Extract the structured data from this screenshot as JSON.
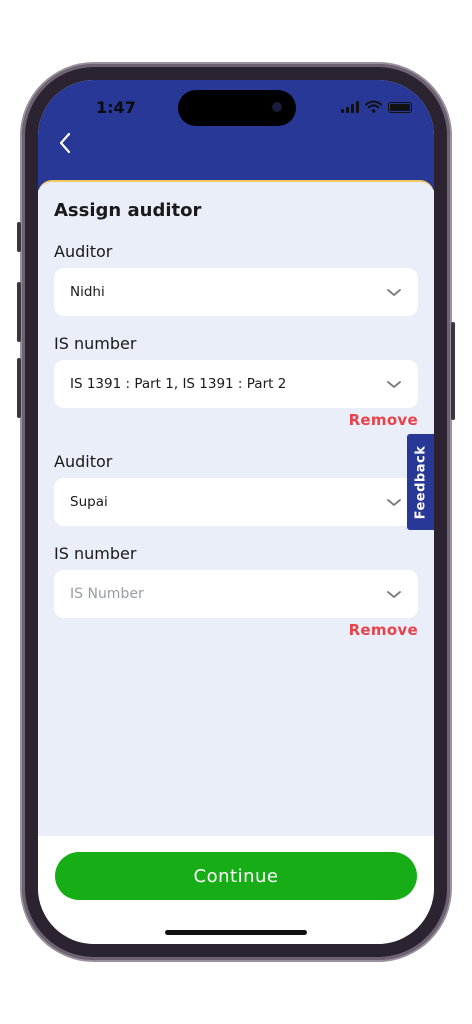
{
  "status": {
    "time": "1:47"
  },
  "header": {
    "back_icon": "chevron-left-icon"
  },
  "form": {
    "title": "Assign auditor",
    "entries": [
      {
        "auditor_label": "Auditor",
        "auditor_value": "Nidhi",
        "is_label": "IS number",
        "is_value": "IS 1391 : Part 1, IS 1391 : Part 2",
        "remove_label": "Remove"
      },
      {
        "auditor_label": "Auditor",
        "auditor_value": "Supai",
        "is_label": "IS number",
        "is_placeholder": "IS Number",
        "remove_label": "Remove"
      }
    ]
  },
  "feedback": {
    "label": "Feedback"
  },
  "footer": {
    "continue_label": "Continue"
  },
  "colors": {
    "header": "#283896",
    "background": "#eaeef9",
    "accent_green": "#17ad17",
    "remove_red": "#e8434a"
  }
}
